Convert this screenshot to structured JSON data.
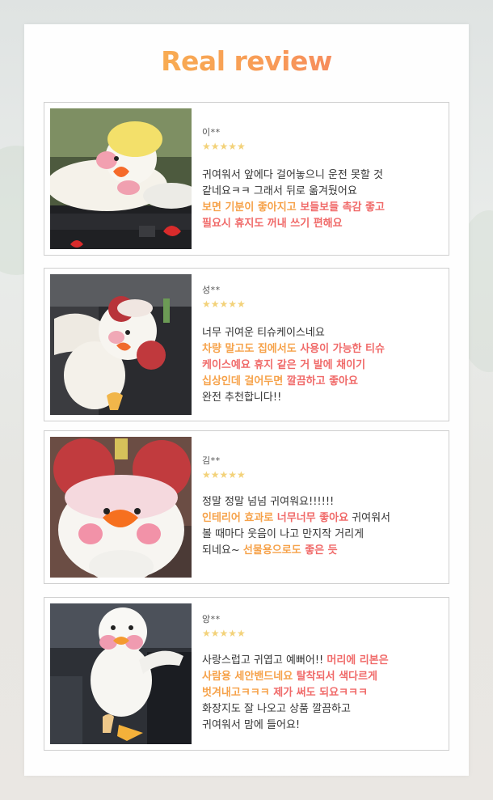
{
  "page": {
    "title": "Real review"
  },
  "reviews": [
    {
      "name": "이**",
      "stars": "★★★★★",
      "lines": [
        [
          {
            "t": "귀여워서 앞에다 걸어놓으니 운전 못할 것",
            "s": "n"
          }
        ],
        [
          {
            "t": "같네요ㅋㅋ 그래서 뒤로 옮겨뒀어요",
            "s": "n"
          }
        ],
        [
          {
            "t": "보면 기분이 좋아지고 ",
            "s": "o"
          },
          {
            "t": "보들보들 촉감 좋고",
            "s": "r"
          }
        ],
        [
          {
            "t": "필요시 휴지도 꺼내 쓰기 편해요",
            "s": "r"
          }
        ]
      ]
    },
    {
      "name": "성**",
      "stars": "★★★★★",
      "lines": [
        [
          {
            "t": "너무 귀여운 티슈케이스네요",
            "s": "n"
          }
        ],
        [
          {
            "t": "차량 말고도 집에서도 ",
            "s": "o"
          },
          {
            "t": "사용이 가능한 티슈",
            "s": "r"
          }
        ],
        [
          {
            "t": "케이스예요 ",
            "s": "r"
          },
          {
            "t": "휴지 같은 거 발에 채이기",
            "s": "r"
          }
        ],
        [
          {
            "t": "십상인데 걸어두면 ",
            "s": "o"
          },
          {
            "t": "깔끔하고 좋아요",
            "s": "r"
          }
        ],
        [
          {
            "t": "완전 추천합니다!!",
            "s": "n"
          }
        ]
      ]
    },
    {
      "name": "김**",
      "stars": "★★★★★",
      "lines": [
        [
          {
            "t": "정말 정말 넘넘 귀여워요!!!!!!",
            "s": "n"
          }
        ],
        [
          {
            "t": "인테리어 효과로 ",
            "s": "o"
          },
          {
            "t": "너무너무 좋아요",
            "s": "r"
          },
          {
            "t": " 귀여워서",
            "s": "n"
          }
        ],
        [
          {
            "t": "볼 때마다 웃음이 나고 만지작 거리게",
            "s": "n"
          }
        ],
        [
          {
            "t": "되네요~ ",
            "s": "n"
          },
          {
            "t": "선물용으로도 ",
            "s": "o"
          },
          {
            "t": "좋은 듯",
            "s": "r"
          }
        ]
      ]
    },
    {
      "name": "앙**",
      "stars": "★★★★★",
      "lines": [
        [
          {
            "t": "사랑스럽고 귀엽고 예뻐어!! ",
            "s": "n"
          },
          {
            "t": "머리에 리본은",
            "s": "r"
          }
        ],
        [
          {
            "t": "사람용 세안밴드네요 ",
            "s": "o"
          },
          {
            "t": "탈착되서 색다르게",
            "s": "r"
          }
        ],
        [
          {
            "t": "벗겨내고ㅋㅋㅋ ",
            "s": "o"
          },
          {
            "t": "제가 써도 되요ㅋㅋㅋ",
            "s": "r"
          }
        ],
        [
          {
            "t": "화장지도 잘 나오고 상품 깔끔하고",
            "s": "n"
          }
        ],
        [
          {
            "t": "귀여워서 맘에 들어요!",
            "s": "n"
          }
        ]
      ]
    }
  ],
  "colors": {
    "highlight_orange": "#f6a24a",
    "highlight_red": "#f06a69",
    "stars": "#f3d27a"
  }
}
